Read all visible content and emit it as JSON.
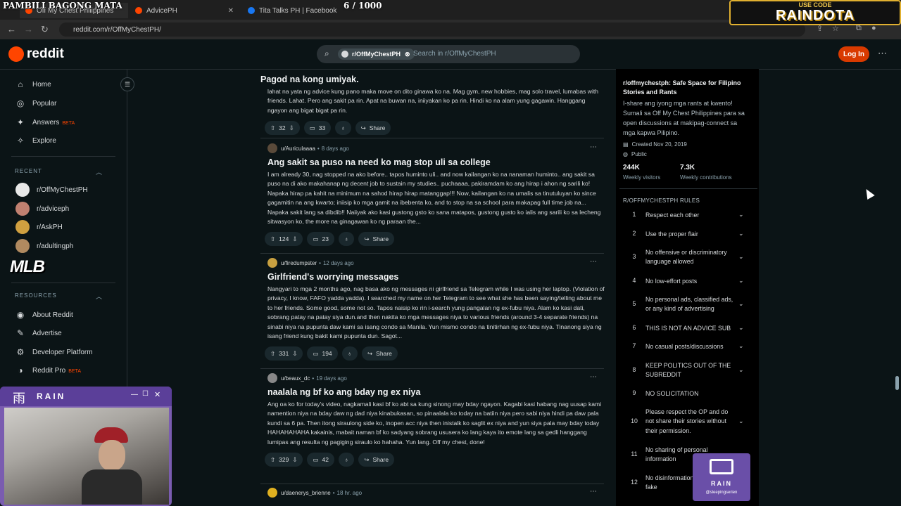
{
  "overlay": {
    "title": "PAMBILI BAGONG MATA",
    "count": "6  / 1000",
    "usecode": "USE CODE",
    "code": "RAINDOTA",
    "mlb": "MLB"
  },
  "tabs": [
    {
      "label": "Off My Chest Philippines"
    },
    {
      "label": "AdvicePH"
    },
    {
      "label": "Tita Talks PH | Facebook"
    }
  ],
  "browser": {
    "url": "reddit.com/r/OffMyChestPH/"
  },
  "header": {
    "brand": "reddit",
    "search_chip": "r/OffMyChestPH",
    "search_placeholder": "Search in r/OffMyChestPH",
    "login": "Log In"
  },
  "sidebar": {
    "nav": [
      {
        "label": "Home"
      },
      {
        "label": "Popular"
      },
      {
        "label": "Answers",
        "badge": "BETA"
      },
      {
        "label": "Explore"
      }
    ],
    "recent_head": "RECENT",
    "recent": [
      {
        "label": "r/OffMyChestPH"
      },
      {
        "label": "r/adviceph"
      },
      {
        "label": "r/AskPH"
      },
      {
        "label": "r/adultingph"
      }
    ],
    "resources_head": "RESOURCES",
    "resources": [
      {
        "label": "About Reddit"
      },
      {
        "label": "Advertise"
      },
      {
        "label": "Developer Platform"
      },
      {
        "label": "Reddit Pro",
        "badge": "BETA"
      }
    ]
  },
  "posts": [
    {
      "title": "Pagod na kong umiyak.",
      "body": "lahat na yata ng advice kung pano maka move on dito ginawa ko na. Mag gym, new hobbies, mag solo travel, lumabas with friends. Lahat. Pero ang sakit pa rin. Apat na buwan na, iniiyakan ko pa rin. Hindi ko na alam yung gagawin. Hanggang ngayon ang bigat bigat pa rin.",
      "votes": "32",
      "comments": "33",
      "share": "Share"
    },
    {
      "author": "u/Auriculaaaa",
      "time": "8 days ago",
      "title": "Ang sakit sa puso na need ko mag stop uli sa college",
      "body": "I am already 30, nag stopped na ako before.. tapos huminto uli.. and now kailangan ko na nanaman huminto.. ang sakit sa puso na di ako makahanap ng decent job to sustain my studies.. puchaaaa, pakiramdam ko ang hirap i ahon ng sarili ko! Napaka hirap pa kahit na minimum na sahod hirap hirap matanggap!!! Now, kailangan ko na umalis sa tinutuluyan ko since gagamitin na ang kwarto; iniisip ko mga gamit na ibebenta ko, and to stop na sa school para makapag full time job na... Napaka sakit lang sa dibdib!! Naiiyak ako kasi gustong gsto ko sana matapos, gustong gusto ko ialis ang sarili ko sa lecheng sitwasyon ko, the more na ginagawan ko ng paraan the...",
      "votes": "124",
      "comments": "23",
      "share": "Share"
    },
    {
      "author": "u/firedumpster",
      "time": "12 days ago",
      "title": "Girlfriend's worrying messages",
      "body": "Nangyari to mga 2 months ago, nag basa ako ng messages ni girlfriend sa Telegram while I was using her laptop. (Violation of privacy, I know, FAFO yadda yadda). I searched my name on her Telegram to see what she has been saying/telling about me to her friends. Some good, some not so. Tapos naisip ko rin i-search yung pangalan ng ex-fubu niya. Alam ko kasi dati, sobrang patay na patay siya dun.and then nakita ko mga messages niya to various friends (around 3-4 separate friends) na sinabi niya na pupunta daw kami sa isang condo sa Manila. Yun mismo condo na tinitirhan ng ex-fubu niya. Tinanong siya ng isang friend kung bakit kami pupunta dun. Sagot...",
      "votes": "331",
      "comments": "194",
      "share": "Share"
    },
    {
      "author": "u/beaux_dc",
      "time": "19 days ago",
      "title": "naalala ng bf ko ang bday ng ex niya",
      "body": "Ang oa ko for today's video, nagkamali kasi bf ko abt sa kung sinong may bday ngayon. Kagabi kasi habang nag uusap kami namention niya na bday daw ng dad niya kinabukasan, so pinaalala ko today na batiin niya pero sabi niya hindi pa daw pala kundi sa 6 pa. Then itong siraulong side ko, inopen acc niya then inistalk ko saglit ex niya and yun siya pala may bday today HAHAHAHAHA kakainis, mabait naman bf ko sadyang sobrang ususera ko lang kaya ito emote lang sa gedli hanggang lumipas ang resulta ng pagiging siraulo ko hahaha. Yun lang. Off my chest, done!",
      "votes": "329",
      "comments": "42",
      "share": "Share"
    },
    {
      "author": "u/daenerys_brienne",
      "time": "18 hr. ago"
    }
  ],
  "about": {
    "title": "r/offmychestph: Safe Space for Filipino Stories and Rants",
    "desc": "I-share ang iyong mga rants at kwento! Sumali sa Off My Chest Philippines para sa open discussions at makipag-connect sa mga kapwa Pilipino.",
    "created": "Created Nov 20, 2019",
    "visibility": "Public",
    "visitors": "244K",
    "visitors_label": "Weekly visitors",
    "contrib": "7.3K",
    "contrib_label": "Weekly contributions",
    "rules_head": "R/OFFMYCHESTPH RULES"
  },
  "rules": [
    {
      "n": "1",
      "t": "Respect each other"
    },
    {
      "n": "2",
      "t": "Use the proper flair"
    },
    {
      "n": "3",
      "t": "No offensive or discriminatory language allowed"
    },
    {
      "n": "4",
      "t": "No low-effort posts"
    },
    {
      "n": "5",
      "t": "No personal ads, classified ads, or any kind of advertising"
    },
    {
      "n": "6",
      "t": "THIS IS NOT AN ADVICE SUB"
    },
    {
      "n": "7",
      "t": "No casual posts/discussions"
    },
    {
      "n": "8",
      "t": "KEEP POLITICS OUT OF THE SUBREDDIT"
    },
    {
      "n": "9",
      "t": "NO SOLICITATION"
    },
    {
      "n": "10",
      "t": "Please respect the OP and do not share their stories without their permission."
    },
    {
      "n": "11",
      "t": "No sharing of personal information"
    },
    {
      "n": "12",
      "t": "No disinformation or spreading of fake"
    }
  ],
  "cam": {
    "name": "RAIN",
    "glyph": "雨"
  },
  "badge": {
    "name": "RAIN",
    "handle": "@sleepingserien"
  },
  "colors": {
    "accent": "#ff4500",
    "login": "#d93a00",
    "bg": "#0b1416"
  }
}
